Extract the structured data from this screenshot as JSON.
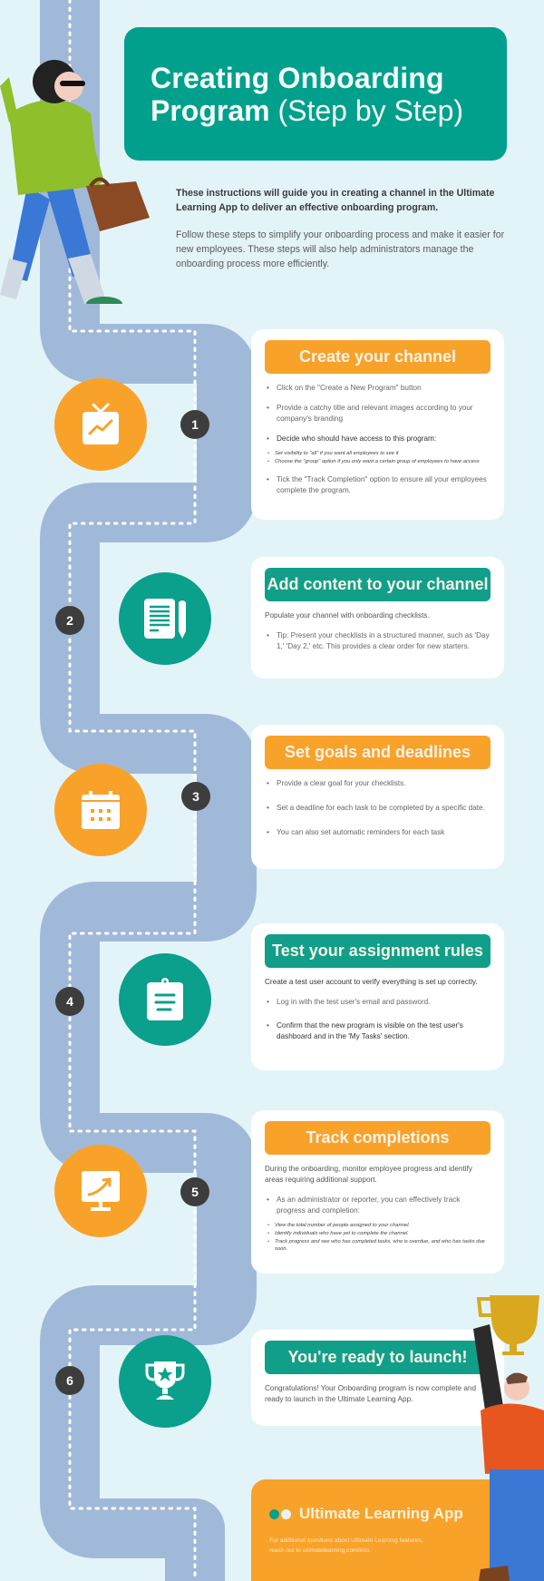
{
  "header": {
    "title_line1": "Creating Onboarding",
    "title_line2_bold": "Program",
    "title_line2_light": "(Step by Step)"
  },
  "intro": {
    "bold_text": "These instructions will guide you in creating a channel in the Ultimate Learning App to deliver an effective onboarding program.",
    "regular_text": "Follow these steps to simplify your onboarding process and make it easier for new employees. These steps will also help administrators manage the onboarding process more efficiently."
  },
  "colors": {
    "teal": "#00a08c",
    "orange": "#f9a22a",
    "path": "#a1b9d9",
    "background": "#e3f4f9",
    "badge": "#3d3d3d"
  },
  "steps": [
    {
      "number": "1",
      "icon": "tv-chart-icon",
      "title": "Create your channel",
      "color": "orange",
      "bullets": [
        "Click on the \"Create a New Program\" button",
        "Provide a catchy title and relevant images according to your company's branding",
        "Decide who should have access to this program:"
      ],
      "sub_bullets": [
        "Set visibility to \"all\" if you want all employees to see it",
        "Choose the \"group\" option if you only want a certain group of employees to have access"
      ],
      "bullet_after": "Tick the \"Track Completion\" option to ensure all your employees complete the program."
    },
    {
      "number": "2",
      "icon": "document-pencil-icon",
      "title": "Add content to your channel",
      "color": "teal",
      "intro": "Populate your channel with onboarding checklists.",
      "bullets": [
        "Tip: Present your checklists in a structured manner, such as 'Day 1,' 'Day 2,' etc. This provides a clear order for new starters."
      ]
    },
    {
      "number": "3",
      "icon": "calendar-icon",
      "title": "Set goals and deadlines",
      "color": "orange",
      "bullets": [
        "Provide a clear goal for your checklists.",
        "Set a deadline for each task to be completed by a specific date.",
        "You can also set automatic reminders for each task"
      ]
    },
    {
      "number": "4",
      "icon": "clipboard-icon",
      "title": "Test your assignment rules",
      "color": "teal",
      "intro": "Create a test user account to verify everything is set up correctly.",
      "bullets": [
        "Log in with the test user's email and password.",
        "Confirm that the new program is visible on the test user's dashboard and in the 'My Tasks' section."
      ]
    },
    {
      "number": "5",
      "icon": "monitor-growth-icon",
      "title": "Track completions",
      "color": "orange",
      "intro": "During the onboarding, monitor employee progress and identify areas requiring additional support.",
      "bullets": [
        "As an administrator or reporter, you can effectively track progress and completion:"
      ],
      "sub_bullets": [
        "View the total number of people assigned to your channel.",
        "Identify individuals who have yet to complete the channel.",
        "Track progress and see who has completed tasks, who is overdue, and who has tasks due soon."
      ]
    },
    {
      "number": "6",
      "icon": "trophy-star-icon",
      "title": "You're ready to launch!",
      "color": "teal",
      "intro": "Congratulations! Your Onboarding program is now complete and ready to launch in the Ultimate Learning App."
    }
  ],
  "footer": {
    "brand_name": "Ultimate Learning App",
    "info_text": "For additional questions about Ultimate Learning features, reach out to ultimatelearning.com/info."
  }
}
